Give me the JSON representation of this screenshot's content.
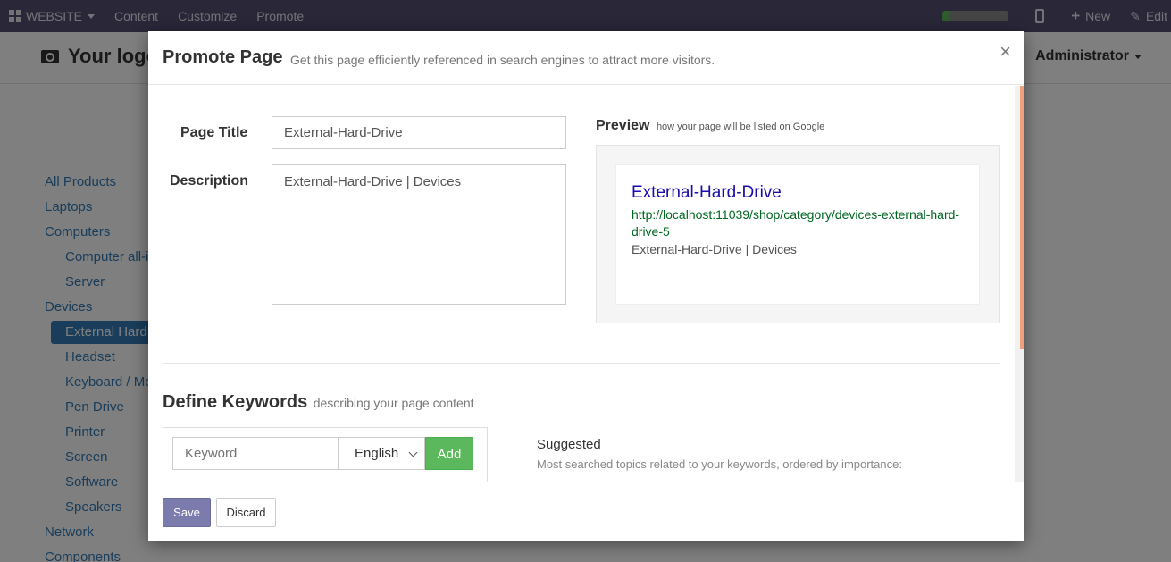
{
  "topbar": {
    "website_label": "WEBSITE",
    "menu": [
      "Content",
      "Customize",
      "Promote"
    ],
    "progress_fraction": 0.1,
    "new_label": "New",
    "edit_label": "Edit"
  },
  "header": {
    "logo_text": "Your logo",
    "user_name": "Administrator"
  },
  "sidebar": {
    "categories": [
      {
        "label": "All Products",
        "level": 0
      },
      {
        "label": "Laptops",
        "level": 0
      },
      {
        "label": "Computers",
        "level": 0
      },
      {
        "label": "Computer all-in-one",
        "level": 1
      },
      {
        "label": "Server",
        "level": 1
      },
      {
        "label": "Devices",
        "level": 0
      },
      {
        "label": "External Hard Drive",
        "level": 1,
        "active": true
      },
      {
        "label": "Headset",
        "level": 1
      },
      {
        "label": "Keyboard / Mouse",
        "level": 1
      },
      {
        "label": "Pen Drive",
        "level": 1
      },
      {
        "label": "Printer",
        "level": 1
      },
      {
        "label": "Screen",
        "level": 1
      },
      {
        "label": "Software",
        "level": 1
      },
      {
        "label": "Speakers",
        "level": 1
      },
      {
        "label": "Network",
        "level": 0
      },
      {
        "label": "Components",
        "level": 0
      }
    ]
  },
  "modal": {
    "title": "Promote Page",
    "subtitle": "Get this page efficiently referenced in search engines to attract more visitors.",
    "close_symbol": "×",
    "page_title_label": "Page Title",
    "page_title_value": "External-Hard-Drive",
    "description_label": "Description",
    "description_value": "External-Hard-Drive | Devices",
    "preview": {
      "heading": "Preview",
      "subheading": "how your page will be listed on Google",
      "result_title": "External-Hard-Drive",
      "result_url": "http://localhost:11039/shop/category/devices-external-hard-drive-5",
      "result_description": "External-Hard-Drive | Devices"
    },
    "keywords": {
      "heading": "Define Keywords",
      "subheading": "describing your page content",
      "input_placeholder": "Keyword",
      "language": "English",
      "add_label": "Add",
      "suggested_title": "Suggested",
      "suggested_subtitle": "Most searched topics related to your keywords, ordered by importance:"
    },
    "footer": {
      "save_label": "Save",
      "discard_label": "Discard"
    }
  },
  "colors": {
    "topbar": "#534f71",
    "accent_link": "#337ab7",
    "google_title": "#1a0dab",
    "google_url": "#006621",
    "add_button": "#5cb85c",
    "save_button": "#7c7bad"
  }
}
